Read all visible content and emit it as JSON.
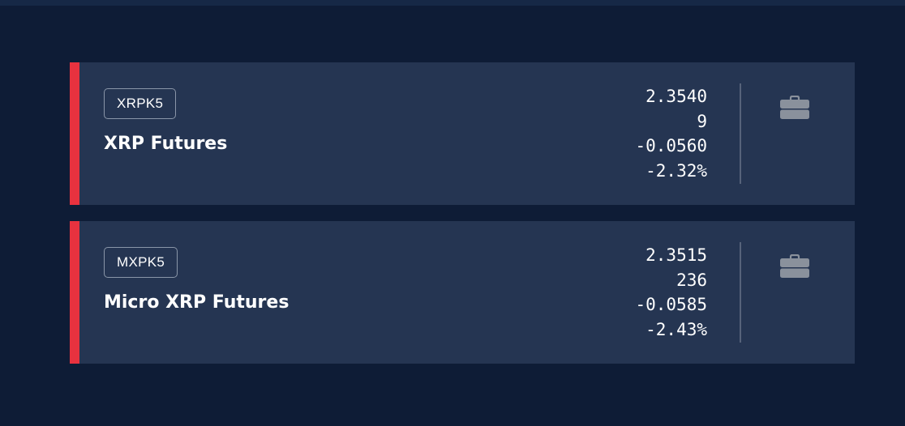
{
  "colors": {
    "background": "#0e1c36",
    "card": "#253552",
    "negative_accent": "#e8323f",
    "icon": "#8a919c"
  },
  "contracts": [
    {
      "symbol": "XRPK5",
      "name": "XRP Futures",
      "last": "2.3540",
      "volume": "9",
      "change": "-0.0560",
      "change_pct": "-2.32%",
      "trend": "down",
      "action_icon": "briefcase-icon"
    },
    {
      "symbol": "MXPK5",
      "name": "Micro XRP Futures",
      "last": "2.3515",
      "volume": "236",
      "change": "-0.0585",
      "change_pct": "-2.43%",
      "trend": "down",
      "action_icon": "briefcase-icon"
    }
  ]
}
